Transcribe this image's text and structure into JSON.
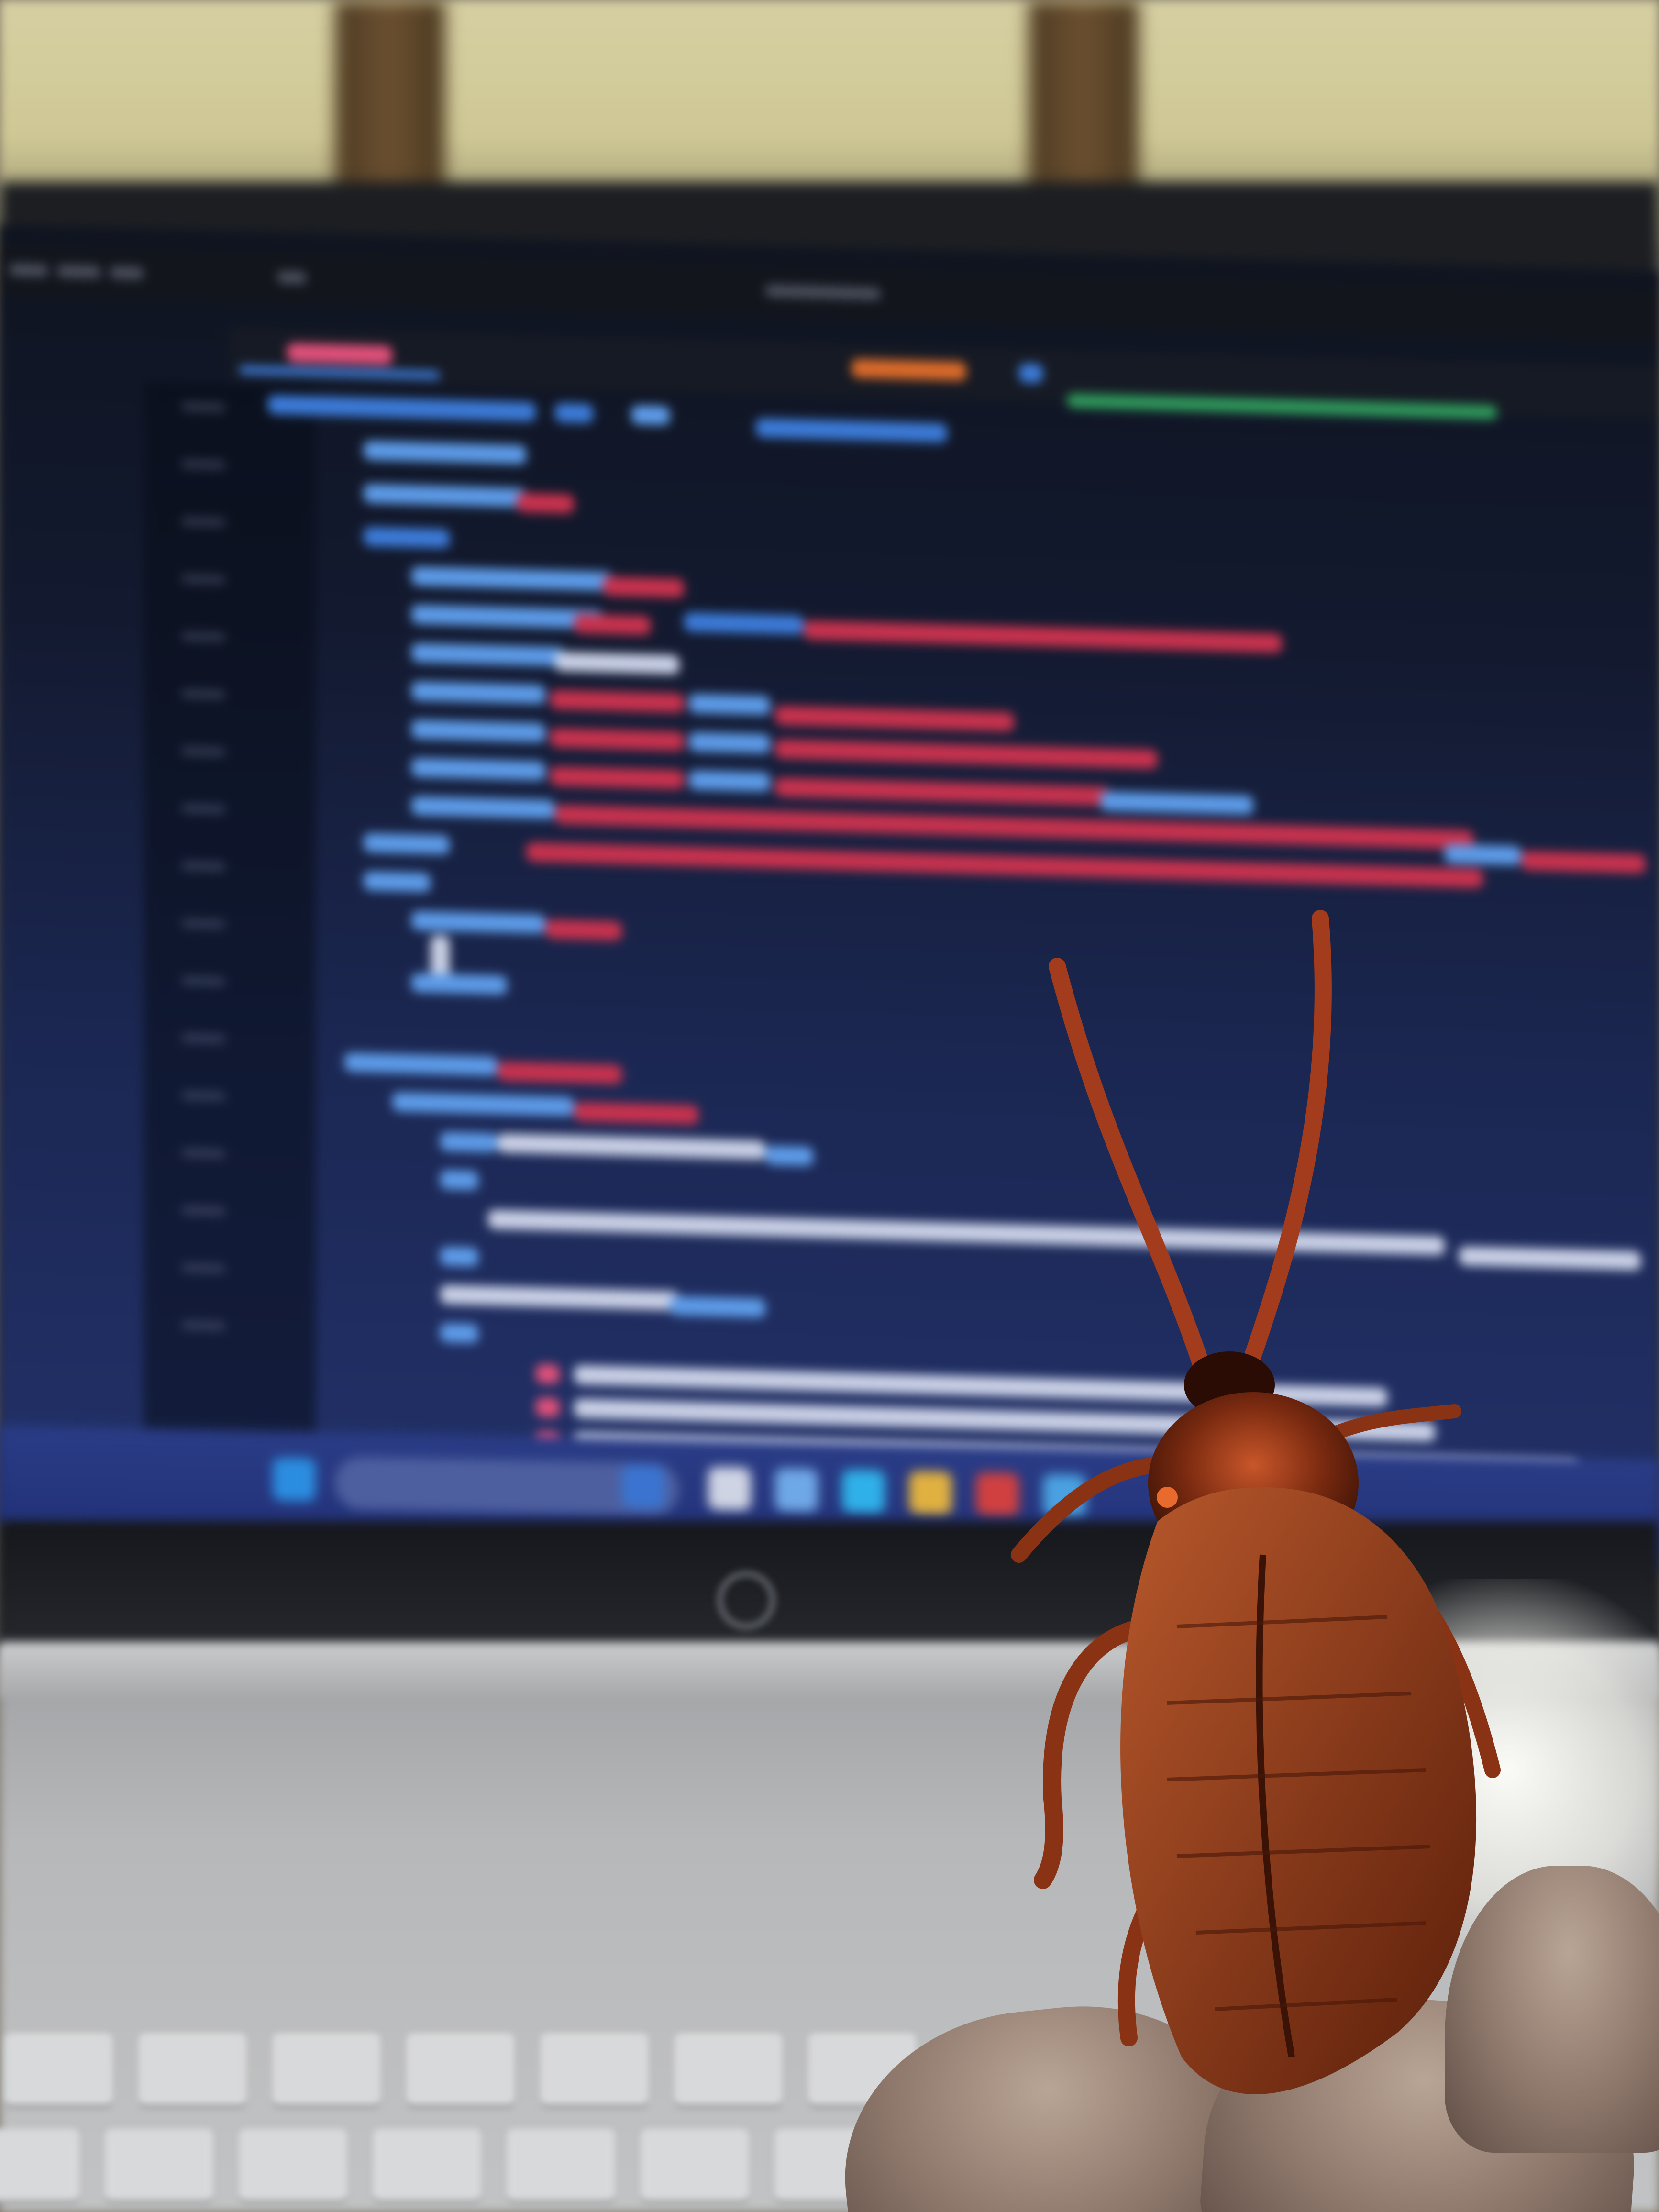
{
  "scene": {
    "subject": "",
    "colors": {
      "wall": "#d6cfa2",
      "screen_top": "#0f1420",
      "screen_bottom": "#22316a",
      "taskbar": "#2a3c86",
      "deck": "#b7b8ba",
      "roach_body": "#7a2a10",
      "roach_highlight": "#c8562a",
      "skin": "#b9a596"
    },
    "icons": [
      "hp-logo-icon",
      "windows-start-icon",
      "search-icon"
    ]
  }
}
